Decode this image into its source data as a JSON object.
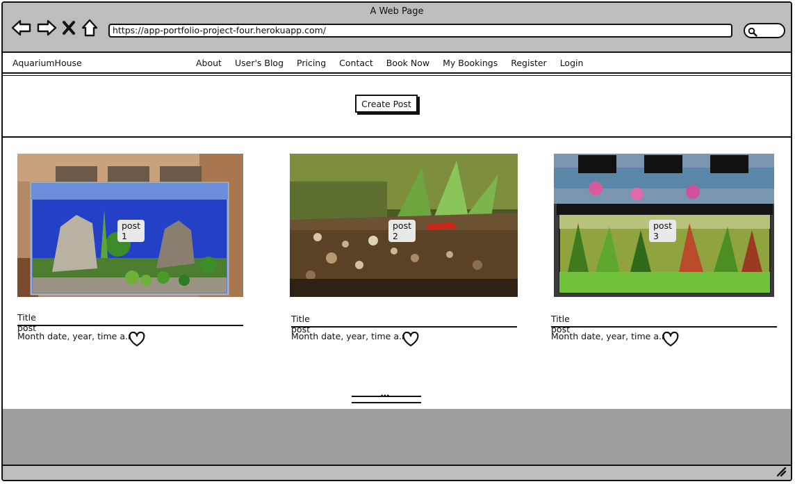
{
  "browser": {
    "window_title": "A Web Page",
    "url": "https://app-portfolio-project-four.herokuapp.com/"
  },
  "navbar": {
    "brand": "AquariumHouse",
    "items": [
      "About",
      "User's Blog",
      "Pricing",
      "Contact",
      "Book Now",
      "My Bookings",
      "Register",
      "Login"
    ]
  },
  "hero": {
    "create_post_label": "Create Post"
  },
  "posts": [
    {
      "tag": "post 1",
      "title": "Title post",
      "date": "Month date, year, time a.m."
    },
    {
      "tag": "post 2",
      "title": "Title post",
      "date": "Month date, year, time a.m."
    },
    {
      "tag": "post 3",
      "title": "Title post",
      "date": "Month date, year, time a.m."
    }
  ],
  "pagination": {
    "dots": "•••"
  },
  "colors": {
    "chrome": "#bdbdbd",
    "footer": "#9e9e9e",
    "ink": "#111111"
  }
}
